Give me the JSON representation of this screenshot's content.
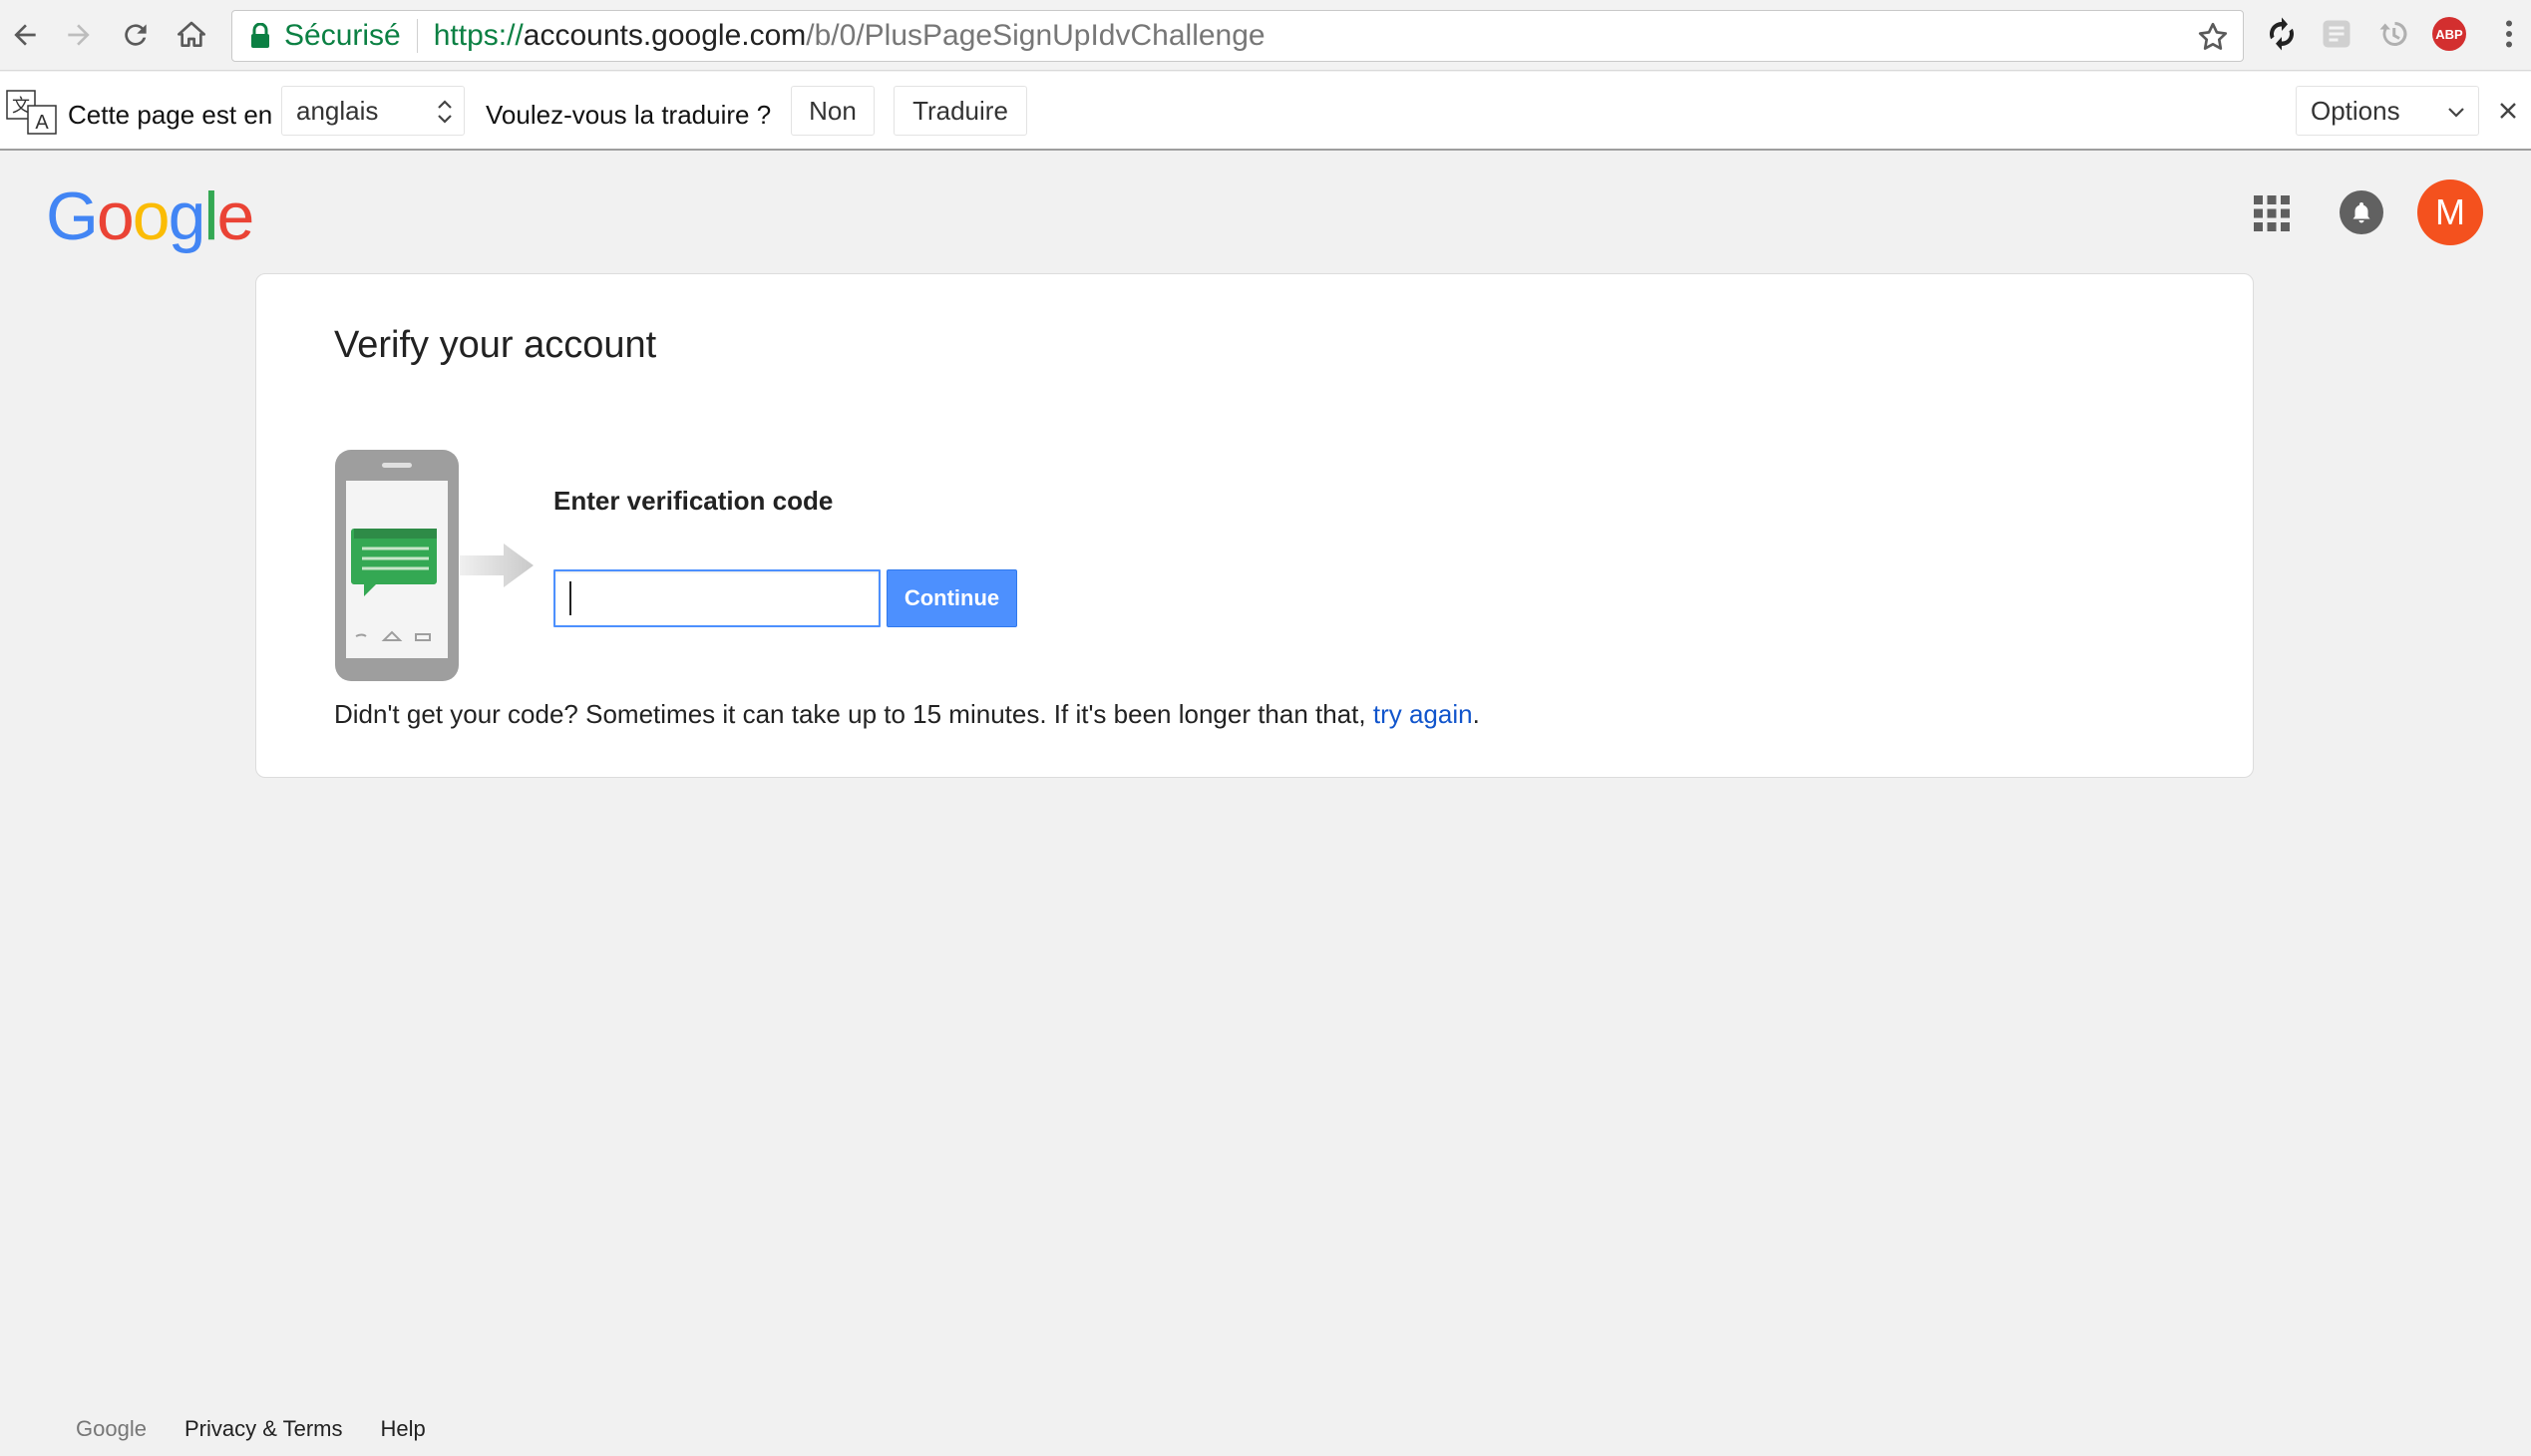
{
  "browser": {
    "secure_label": "Sécurisé",
    "url_scheme": "https://",
    "url_host": "accounts.google.com",
    "url_path": "/b/0/PlusPageSignUpIdvChallenge",
    "extensions": [
      "sync-icon",
      "reader-icon",
      "history-icon",
      "adblock-icon",
      "menu-icon"
    ],
    "abp_label": "ABP"
  },
  "translate_bar": {
    "prefix": "Cette page est en",
    "language": "anglais",
    "question": "Voulez-vous la traduire ?",
    "no_label": "Non",
    "translate_label": "Traduire",
    "options_label": "Options"
  },
  "header": {
    "logo_letters": [
      "G",
      "o",
      "o",
      "g",
      "l",
      "e"
    ],
    "logo_colors": [
      "#4285f4",
      "#ea4335",
      "#fbbc05",
      "#4285f4",
      "#34a853",
      "#ea4335"
    ],
    "avatar_letter": "M",
    "avatar_color": "#f4511e"
  },
  "card": {
    "title": "Verify your account",
    "code_label": "Enter verification code",
    "code_value": "",
    "continue_label": "Continue",
    "help_prefix": "Didn't get your code? Sometimes it can take up to 15 minutes. If it's been longer than that, ",
    "help_link": "try again",
    "help_suffix": "."
  },
  "footer": {
    "brand": "Google",
    "privacy_label": "Privacy & Terms",
    "help_label": "Help"
  },
  "colors": {
    "accent": "#4d90fe",
    "link": "#1155cc",
    "secure": "#0b8043"
  }
}
